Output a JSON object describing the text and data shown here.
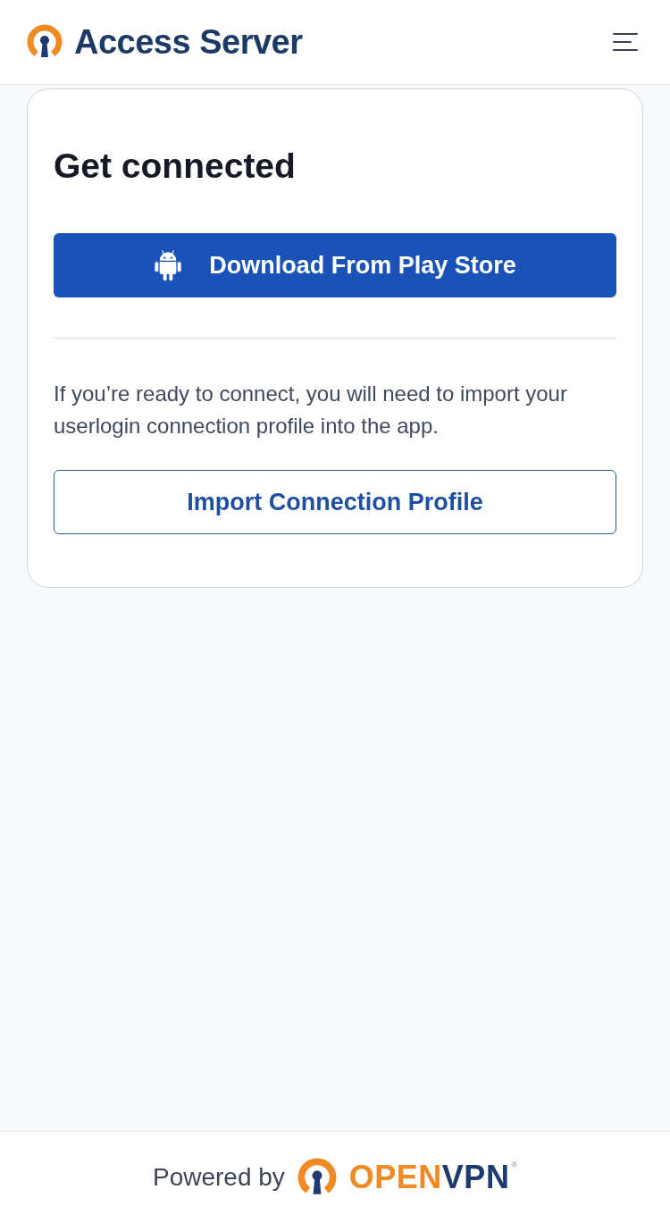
{
  "header": {
    "title": "Access Server"
  },
  "card": {
    "title": "Get connected",
    "primary_button": {
      "label": "Download From Play Store"
    },
    "message": "If you’re ready to connect, you will need to import your userlogin connection profile into the app.",
    "secondary_button": {
      "label": "Import Connection Profile"
    }
  },
  "footer": {
    "label": "Powered by",
    "brand": [
      {
        "text": "OPEN",
        "color": "#f08a24"
      },
      {
        "text": "VPN",
        "color": "#1e3a6e"
      }
    ],
    "registered_mark": "®"
  }
}
